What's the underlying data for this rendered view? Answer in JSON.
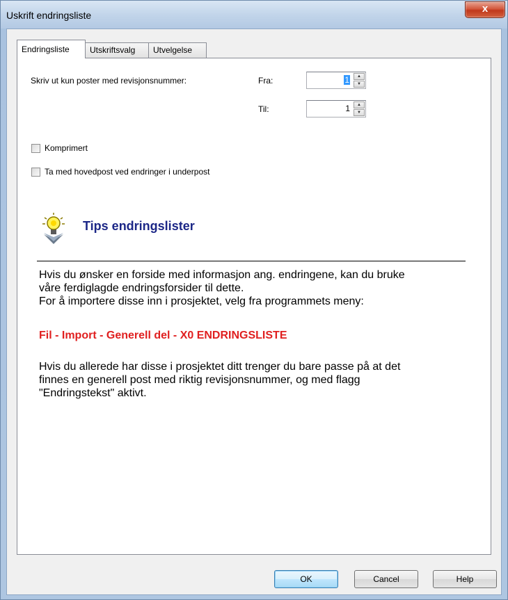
{
  "window": {
    "title": "Uskrift endringsliste",
    "close_label": "x"
  },
  "tabs": [
    {
      "label": "Endringsliste",
      "active": true
    },
    {
      "label": "Utskriftsvalg",
      "active": false
    },
    {
      "label": "Utvelgelse",
      "active": false
    }
  ],
  "revision": {
    "label": "Skriv ut kun poster med revisjonsnummer:",
    "from_label": "Fra:",
    "from_value": "1",
    "to_label": "Til:",
    "to_value": "1"
  },
  "options": {
    "compressed_label": "Komprimert",
    "compressed_checked": false,
    "include_main_label": "Ta med hovedpost ved endringer i underpost",
    "include_main_checked": false
  },
  "tips": {
    "title": "Tips endringslister",
    "para1_line1": "Hvis du ønsker en forside med informasjon ang. endringene, kan du bruke",
    "para1_line2": "våre ferdiglagde endringsforsider til dette.",
    "para1_line3": "For å importere disse inn i prosjektet, velg fra programmets meny:",
    "menu_path": "Fil - Import - Generell del - X0 ENDRINGSLISTE",
    "para2_line1": "Hvis du allerede har disse i prosjektet ditt trenger du bare passe på at det",
    "para2_line2": "finnes en generell post med riktig revisjonsnummer, og med flagg",
    "para2_line3": "\"Endringstekst\" aktivt."
  },
  "buttons": {
    "ok": "OK",
    "cancel": "Cancel",
    "help": "Help"
  },
  "colors": {
    "tips_title": "#1c2787",
    "menu_path": "#e02020",
    "selection": "#3399ff"
  }
}
